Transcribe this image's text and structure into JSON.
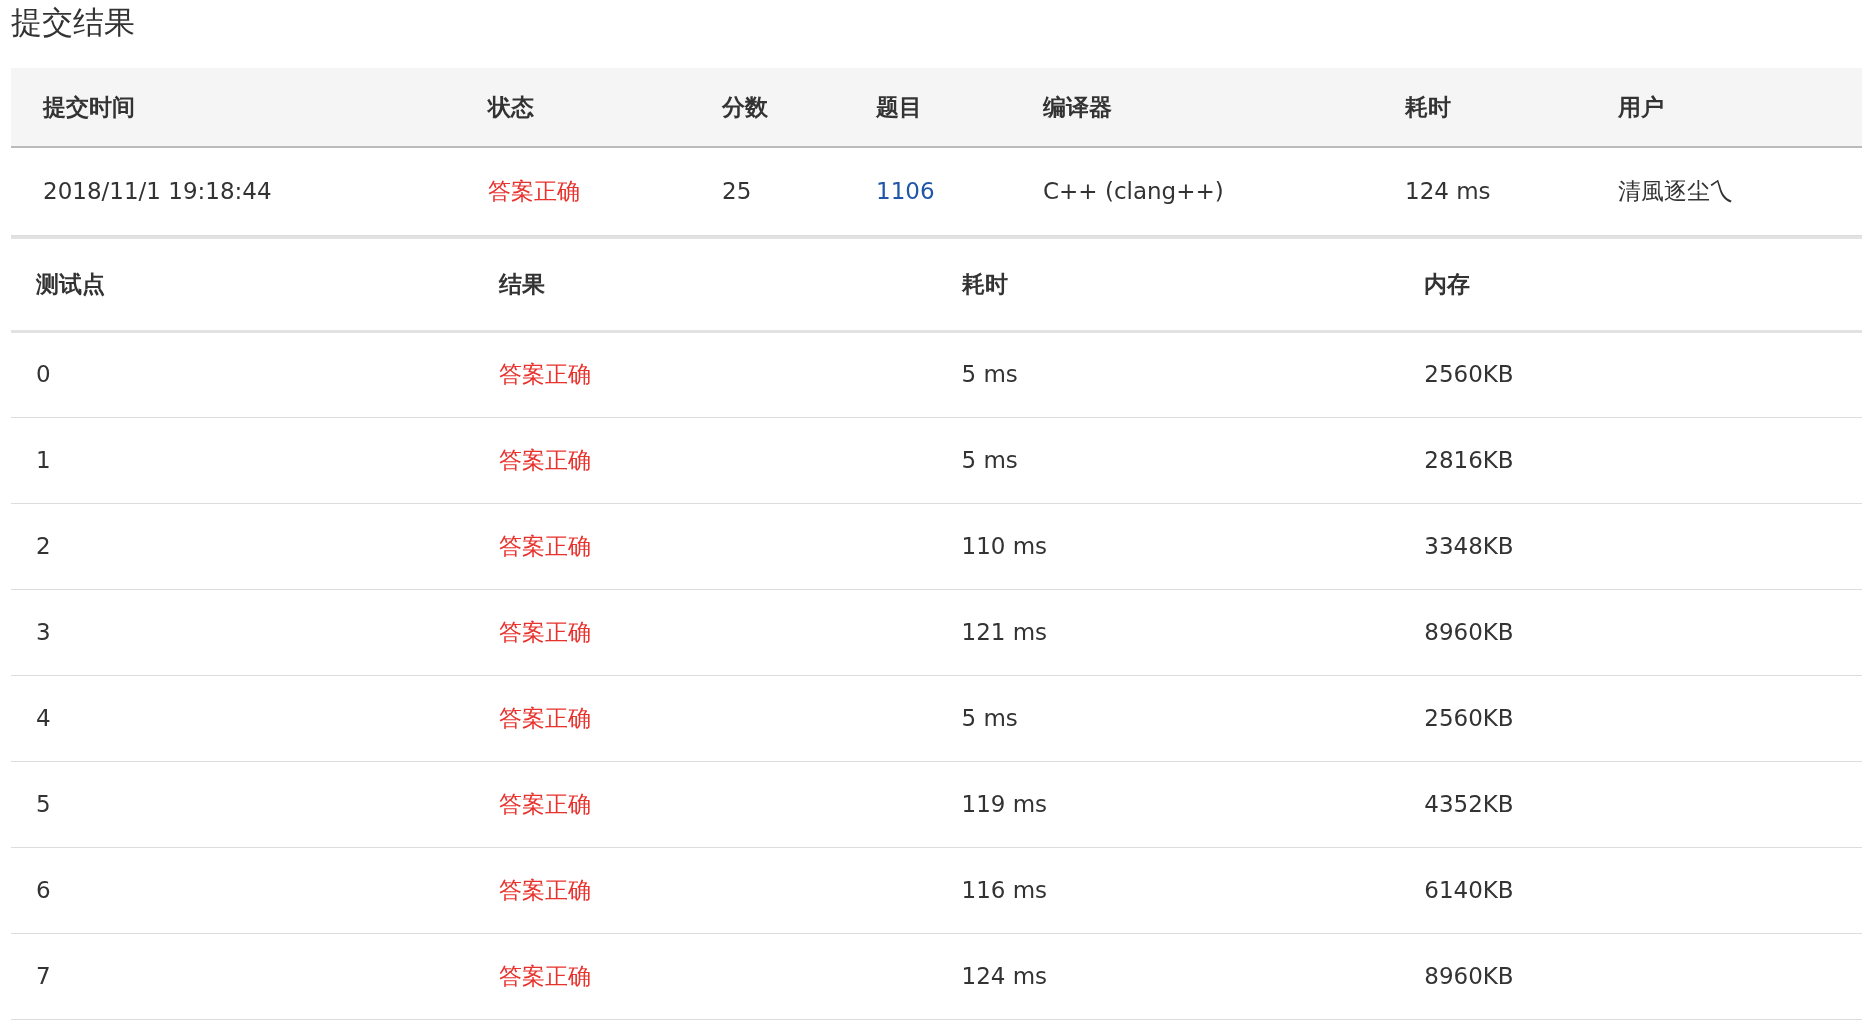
{
  "title": "提交结果",
  "submission": {
    "columns": [
      "提交时间",
      "状态",
      "分数",
      "题目",
      "编译器",
      "耗时",
      "用户"
    ],
    "row": {
      "submitted_at": "2018/11/1 19:18:44",
      "status": "答案正确",
      "score": "25",
      "problem": "1106",
      "compiler": "C++ (clang++)",
      "time": "124 ms",
      "user": "清風逐尘乀"
    }
  },
  "test_points": {
    "columns": [
      "测试点",
      "结果",
      "耗时",
      "内存"
    ],
    "rows": [
      {
        "point": "0",
        "result": "答案正确",
        "time": "5 ms",
        "memory": "2560KB"
      },
      {
        "point": "1",
        "result": "答案正确",
        "time": "5 ms",
        "memory": "2816KB"
      },
      {
        "point": "2",
        "result": "答案正确",
        "time": "110 ms",
        "memory": "3348KB"
      },
      {
        "point": "3",
        "result": "答案正确",
        "time": "121 ms",
        "memory": "8960KB"
      },
      {
        "point": "4",
        "result": "答案正确",
        "time": "5 ms",
        "memory": "2560KB"
      },
      {
        "point": "5",
        "result": "答案正确",
        "time": "119 ms",
        "memory": "4352KB"
      },
      {
        "point": "6",
        "result": "答案正确",
        "time": "116 ms",
        "memory": "6140KB"
      },
      {
        "point": "7",
        "result": "答案正确",
        "time": "124 ms",
        "memory": "8960KB"
      }
    ]
  }
}
